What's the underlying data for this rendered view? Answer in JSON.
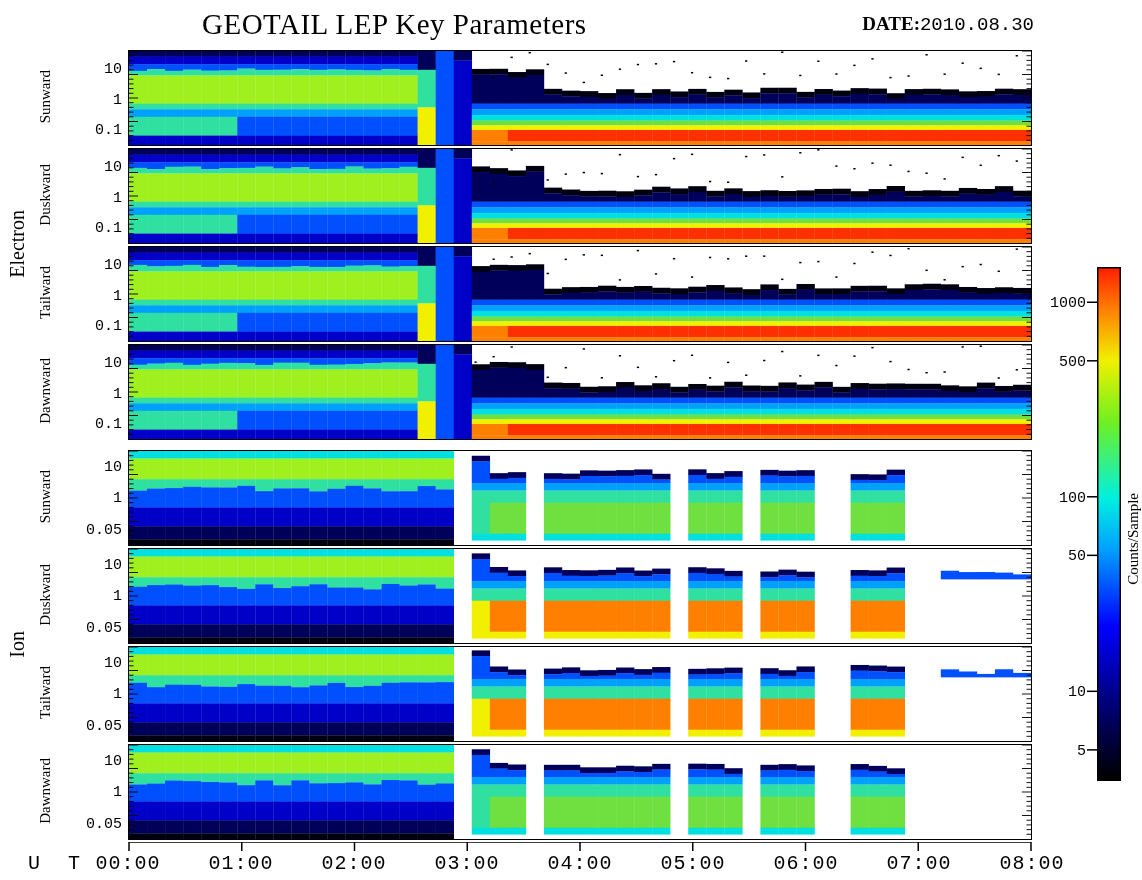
{
  "title": "GEOTAIL LEP Key Parameters",
  "date": "**DATE:**2010.08.30",
  "groups": [
    {
      "label": "Electron",
      "kind": "electron",
      "panels": [
        {
          "label": "Sunward",
          "kind": "electron",
          "yticks": [
            "10",
            "1",
            "0.1"
          ]
        },
        {
          "label": "Duskward",
          "kind": "electron",
          "yticks": [
            "10",
            "1",
            "0.1"
          ]
        },
        {
          "label": "Tailward",
          "kind": "electron",
          "yticks": [
            "10",
            "1",
            "0.1"
          ]
        },
        {
          "label": "Dawnward",
          "kind": "electron",
          "yticks": [
            "10",
            "1",
            "0.1"
          ]
        }
      ]
    },
    {
      "label": "Ion",
      "kind": "ion",
      "panels": [
        {
          "label": "Sunward",
          "kind": "ion-low",
          "yticks": [
            "10",
            "1",
            "0.05"
          ]
        },
        {
          "label": "Duskward",
          "kind": "ion-high",
          "yticks": [
            "10",
            "1",
            "0.05"
          ]
        },
        {
          "label": "Tailward",
          "kind": "ion-high",
          "yticks": [
            "10",
            "1",
            "0.05"
          ]
        },
        {
          "label": "Dawnward",
          "kind": "ion-low",
          "yticks": [
            "10",
            "1",
            "0.05"
          ]
        }
      ]
    }
  ],
  "time_axis": {
    "label": "U T",
    "ticks": [
      "00:00",
      "01:00",
      "02:00",
      "03:00",
      "04:00",
      "05:00",
      "06:00",
      "07:00",
      "08:00"
    ]
  },
  "colorbar": {
    "label": "Counts/Sample",
    "ticks": [
      "1000",
      "500",
      "100",
      "50",
      "10",
      "5"
    ]
  }
}
